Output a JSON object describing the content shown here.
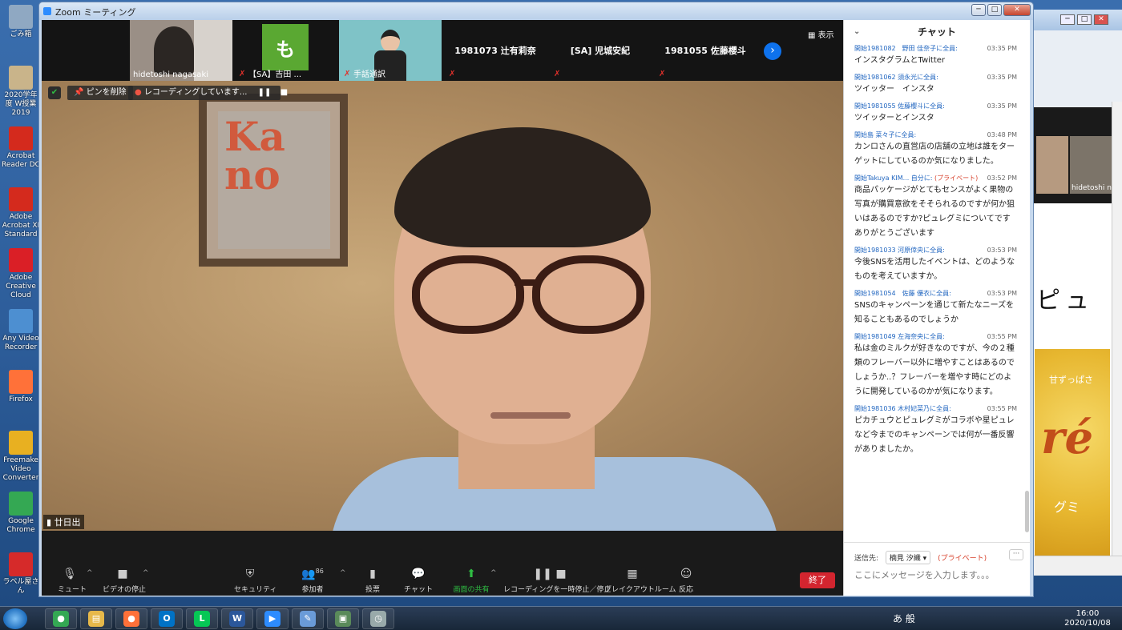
{
  "window": {
    "title": "Zoom ミーティング"
  },
  "desktop_icons": [
    {
      "label": "ごみ箱",
      "color": "#8fa8c2"
    },
    {
      "label": "2020学年度 W授業2019",
      "color": "#c9b48a"
    },
    {
      "label": "Acrobat Reader DC",
      "color": "#d42a1d"
    },
    {
      "label": "Adobe Acrobat XI Standard",
      "color": "#d42a1d"
    },
    {
      "label": "Adobe Creative Cloud",
      "color": "#da1f26"
    },
    {
      "label": "Any Video Recorder",
      "color": "#4d8fd1"
    },
    {
      "label": "Firefox",
      "color": "#ff7139"
    },
    {
      "label": "Freemake Video Converter",
      "color": "#e8b021"
    },
    {
      "label": "Google Chrome",
      "color": "#34a853"
    },
    {
      "label": "ラベル屋さん",
      "color": "#d62a2a"
    }
  ],
  "gallery": {
    "tiles": [
      {
        "name": "hidetoshi nagasaki",
        "type": "video",
        "bg": "#9a8f86"
      },
      {
        "name": "【SA】吉田 ...",
        "type": "avatar",
        "avatar_letter": "も",
        "muted": true
      },
      {
        "name": "手話通訳",
        "type": "video",
        "bg": "#7fc3c7",
        "muted": true
      },
      {
        "name": "1981073 辻有莉奈",
        "type": "name",
        "muted": true
      },
      {
        "name": "[SA] 児城安紀",
        "type": "name",
        "muted": true
      },
      {
        "name": "1981055 佐藤櫻斗",
        "type": "name",
        "muted": true
      }
    ],
    "view_label": "表示"
  },
  "main_video": {
    "pin_label": "ピンを削除",
    "recording_label": "レコーディングしています...",
    "speaker_name": "廿日出",
    "sign_text": "Ka\nno"
  },
  "controls": [
    {
      "label": "ミュート",
      "icon": "microphone-icon"
    },
    {
      "label": "ビデオの停止",
      "icon": "video-camera-icon"
    },
    {
      "label": "セキュリティ",
      "icon": "shield-icon"
    },
    {
      "label": "参加者",
      "icon": "participants-icon",
      "count": "86"
    },
    {
      "label": "投票",
      "icon": "poll-icon"
    },
    {
      "label": "チャット",
      "icon": "chat-bubble-icon"
    },
    {
      "label": "画面の共有",
      "icon": "share-screen-icon",
      "color": "#2fbd43"
    },
    {
      "label": "レコーディングを一時停止／停止",
      "icon": "recording-pause-icon"
    },
    {
      "label": "ブレイクアウトルーム",
      "icon": "breakout-rooms-icon"
    },
    {
      "label": "反応",
      "icon": "reaction-icon"
    }
  ],
  "end_button": "終了",
  "chat": {
    "title": "チャット",
    "messages": [
      {
        "from": "開始1981082　野田 佳奈子に全員:",
        "time": "03:35 PM",
        "text": "インスタグラムとTwitter"
      },
      {
        "from": "開始1981062 須永光に全員:",
        "time": "03:35 PM",
        "text": "ツイッター　インスタ"
      },
      {
        "from": "開始1981055 佐藤櫻斗に全員:",
        "time": "03:35 PM",
        "text": "ツイッターとインスタ"
      },
      {
        "from": "開始島 菜々子に全員:",
        "time": "03:48 PM",
        "text": "カンロさんの直営店の店舗の立地は誰をターゲットにしているのか気になりました。"
      },
      {
        "from": "開始Takuya KIM... 自分に:",
        "private": "(プライベート)",
        "time": "03:52 PM",
        "text": "商品パッケージがとてもセンスがよく果物の写真が購買意欲をそそられるのですが何か狙いはあるのですか?ピュレグミについてですありがとうございます"
      },
      {
        "from": "開始1981033 河原倖央に全員:",
        "time": "03:53 PM",
        "text": "今後SNSを活用したイベントは、どのようなものを考えていますか。"
      },
      {
        "from": "開始1981054　佐藤 優衣に全員:",
        "time": "03:53 PM",
        "text": "SNSのキャンペーンを通じて新たなニーズを知ることもあるのでしょうか"
      },
      {
        "from": "開始1981049 左海奈央に全員:",
        "time": "03:55 PM",
        "text": "私は金のミルクが好きなのですが、今の２種類のフレーバー以外に増やすことはあるのでしょうか..？フレーバーを増やす時にどのように開発しているのかが気になります。"
      },
      {
        "from": "開始1981036 木村妃菜乃に全員:",
        "time": "03:55 PM",
        "text": "ピカチュウとピュレグミがコラボや星ピュレなど今までのキャンペーンでは何が一番反響がありましたか。"
      }
    ],
    "send_to_label": "送信先:",
    "send_to_value": "楠見 汐織",
    "send_to_private": "(プライベート)",
    "input_placeholder": "ここにメッセージを入力します。。。"
  },
  "background_window": {
    "doc_text": "ピュ",
    "ad_small": "甘ずっぱさ",
    "ad_script": "ré",
    "ad_kana": "グミ",
    "thumb_label": "hidetoshi n"
  },
  "taskbar": {
    "apps": [
      {
        "name": "chrome-icon",
        "glyph": "●",
        "color": "#34a853"
      },
      {
        "name": "explorer-icon",
        "glyph": "▤",
        "color": "#e6b84a"
      },
      {
        "name": "firefox-icon",
        "glyph": "●",
        "color": "#ff7139"
      },
      {
        "name": "outlook-icon",
        "glyph": "O",
        "color": "#0072c6"
      },
      {
        "name": "line-icon",
        "glyph": "L",
        "color": "#06c755"
      },
      {
        "name": "word-icon",
        "glyph": "W",
        "color": "#2b579a"
      },
      {
        "name": "zoom-icon",
        "glyph": "▶",
        "color": "#2d8cff"
      },
      {
        "name": "paint-icon",
        "glyph": "✎",
        "color": "#6a9bd8"
      },
      {
        "name": "tool-icon",
        "glyph": "▣",
        "color": "#5a8a5a"
      },
      {
        "name": "clock-app-icon",
        "glyph": "◷",
        "color": "#9aa"
      }
    ],
    "tray_text": "あ 般",
    "time": "16:00",
    "date": "2020/10/08"
  }
}
